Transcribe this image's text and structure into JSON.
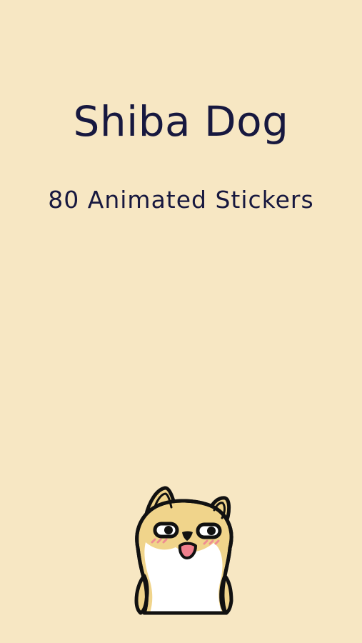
{
  "page": {
    "title": "Shiba Dog",
    "subtitle": "80 Animated Stickers"
  },
  "colors": {
    "background": "#f7e7c3",
    "text": "#17183f",
    "fur": "#f0d48b",
    "belly": "#ffffff",
    "outline": "#111111",
    "blush": "#ef8d92",
    "mouth": "#ef7f8d"
  },
  "illustration": {
    "name": "shiba-dog-sticker"
  }
}
